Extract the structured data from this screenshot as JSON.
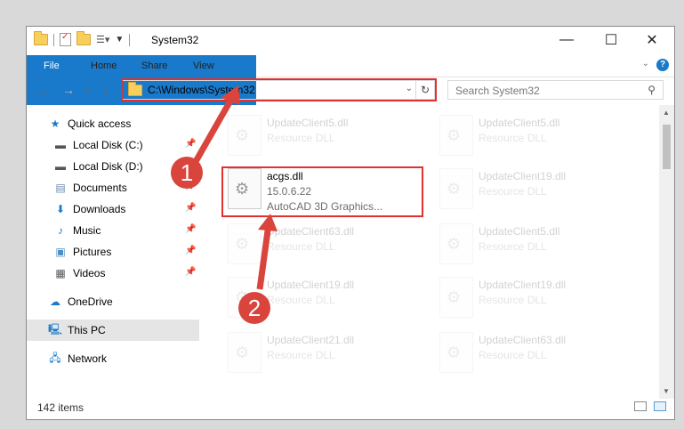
{
  "window": {
    "title": "System32"
  },
  "ribbon": {
    "tabs": [
      "File",
      "Home",
      "Share",
      "View"
    ]
  },
  "nav": {
    "address": "C:\\Windows\\System32",
    "search_placeholder": "Search System32"
  },
  "sidebar": {
    "items": [
      {
        "label": "Quick access",
        "icon": "star-icon"
      },
      {
        "label": "Local Disk (C:)",
        "icon": "drive-icon"
      },
      {
        "label": "Local Disk (D:)",
        "icon": "drive-icon"
      },
      {
        "label": "Documents",
        "icon": "documents-icon"
      },
      {
        "label": "Downloads",
        "icon": "download-icon"
      },
      {
        "label": "Music",
        "icon": "music-icon"
      },
      {
        "label": "Pictures",
        "icon": "pictures-icon"
      },
      {
        "label": "Videos",
        "icon": "videos-icon"
      },
      {
        "label": "OneDrive",
        "icon": "cloud-icon"
      },
      {
        "label": "This PC",
        "icon": "computer-icon"
      },
      {
        "label": "Network",
        "icon": "network-icon"
      }
    ]
  },
  "files": {
    "selected": {
      "name": "acgs.dll",
      "version": "15.0.6.22",
      "desc": "AutoCAD 3D Graphics..."
    },
    "items": [
      {
        "name": "UpdateClient5.dll",
        "desc": "Resource DLL"
      },
      {
        "name": "UpdateClient5.dll",
        "desc": "Resource DLL"
      },
      {
        "name": "UpdateClient19.dll",
        "desc": "Resource DLL"
      },
      {
        "name": "UpdateClient63.dll",
        "desc": "Resource DLL"
      },
      {
        "name": "UpdateClient5.dll",
        "desc": "Resource DLL"
      },
      {
        "name": "UpdateClient19.dll",
        "desc": "Resource DLL"
      },
      {
        "name": "UpdateClient19.dll",
        "desc": "Resource DLL"
      },
      {
        "name": "UpdateClient21.dll",
        "desc": "Resource DLL"
      },
      {
        "name": "UpdateClient63.dll",
        "desc": "Resource DLL"
      }
    ]
  },
  "status": {
    "count": "142 items"
  },
  "annotations": {
    "badge1": "1",
    "badge2": "2"
  },
  "colors": {
    "accent": "#1979ca",
    "highlight": "#e0312f"
  }
}
